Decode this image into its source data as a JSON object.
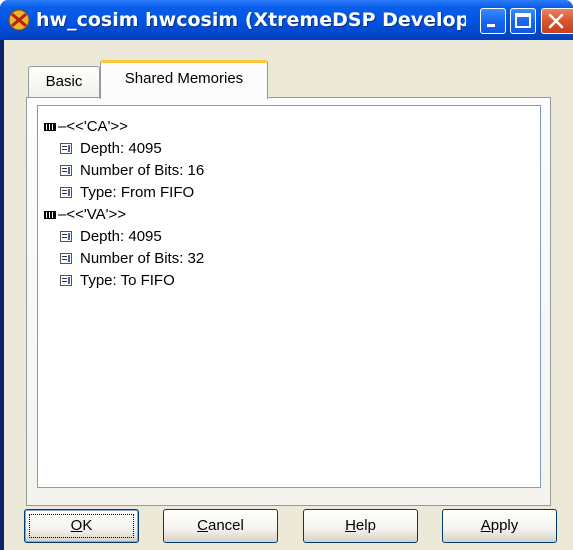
{
  "window": {
    "title": "hw_cosim hwcosim (XtremeDSP Develop...",
    "icon": "xilinx-logo-icon",
    "controls": [
      "minimize-icon",
      "maximize-icon",
      "close-icon"
    ]
  },
  "tabs": [
    {
      "label": "Basic",
      "selected": false
    },
    {
      "label": "Shared Memories",
      "selected": true
    }
  ],
  "tree": {
    "groups": [
      {
        "label": "–<<'CA'>>",
        "items": [
          "Depth: 4095",
          "Number of Bits: 16",
          "Type: From FIFO"
        ]
      },
      {
        "label": "–<<'VA'>>",
        "items": [
          "Depth: 4095",
          "Number of Bits: 32",
          "Type: To FIFO"
        ]
      }
    ]
  },
  "buttons": {
    "ok": {
      "mnemonic": "O",
      "rest": "K"
    },
    "cancel": {
      "mnemonic": "C",
      "rest": "ancel"
    },
    "help": {
      "mnemonic": "H",
      "rest": "elp"
    },
    "apply": {
      "mnemonic": "A",
      "rest": "pply"
    }
  },
  "colors": {
    "titlebar": "#0054e3",
    "dialog_bg": "#ece9d8",
    "active_tab_accent": "#ffc83c",
    "close_button": "#d9532b"
  }
}
